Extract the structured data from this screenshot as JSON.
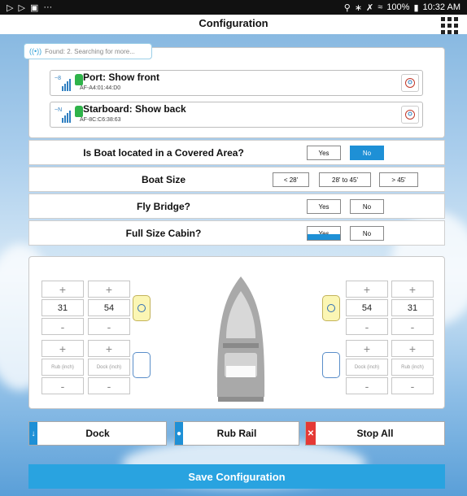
{
  "status_bar": {
    "battery": "100%",
    "time": "10:32 AM",
    "more": "···"
  },
  "title": "Configuration",
  "search": {
    "text": "Found: 2. Searching for more..."
  },
  "devices": [
    {
      "name": "Port: Show front",
      "mac": "AF-A4:01:44:D0"
    },
    {
      "name": "Starboard: Show back",
      "mac": "AF-8C:C6:38:63"
    }
  ],
  "questions": {
    "covered": {
      "label": "Is Boat located in a Covered Area?",
      "yes": "Yes",
      "no": "No",
      "selected": "No"
    },
    "boat_size": {
      "label": "Boat Size",
      "options": [
        "< 28'",
        "28' to 45'",
        "> 45'"
      ]
    },
    "fly_bridge": {
      "label": "Fly Bridge?",
      "yes": "Yes",
      "no": "No"
    },
    "cabin": {
      "label": "Full Size Cabin?",
      "yes": "Yes",
      "no": "No"
    }
  },
  "layout_panel": {
    "plus": "+",
    "minus": "-",
    "port": {
      "value_a": "31",
      "value_b": "54",
      "rub_label": "Rub (inch)",
      "dock_label": "Dock (inch)"
    },
    "starboard": {
      "value_a": "54",
      "value_b": "31",
      "dock_label": "Dock (inch)",
      "rub_label": "Rub (inch)"
    }
  },
  "actions": {
    "dock": "Dock",
    "rub_rail": "Rub Rail",
    "stop_all": "Stop All"
  },
  "save": "Save Configuration",
  "colors": {
    "accent": "#1e90d6",
    "save": "#29a3e0",
    "stop": "#e53935",
    "battery": "#2fb34a"
  }
}
